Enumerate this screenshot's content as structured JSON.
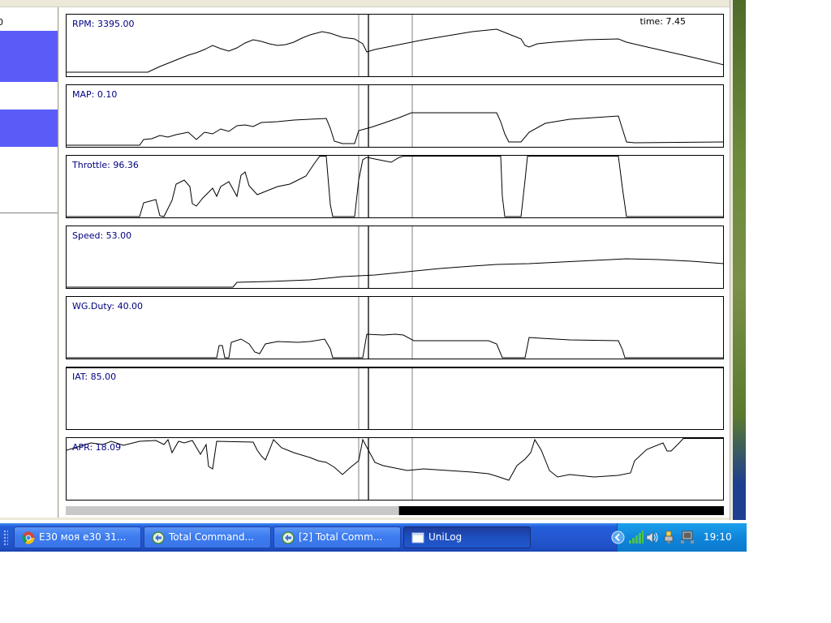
{
  "left_pane": {
    "partial_text": "0"
  },
  "time_readout": "time: 7.45",
  "panels": [
    {
      "key": "rpm",
      "label": "RPM: 3395.00",
      "points": [
        [
          0,
          71
        ],
        [
          100,
          71
        ],
        [
          115,
          64
        ],
        [
          130,
          58
        ],
        [
          150,
          50
        ],
        [
          160,
          47
        ],
        [
          170,
          43
        ],
        [
          180,
          38
        ],
        [
          190,
          42
        ],
        [
          200,
          45
        ],
        [
          210,
          41
        ],
        [
          220,
          35
        ],
        [
          230,
          31
        ],
        [
          240,
          33
        ],
        [
          250,
          36
        ],
        [
          260,
          38
        ],
        [
          270,
          37
        ],
        [
          280,
          34
        ],
        [
          290,
          29
        ],
        [
          300,
          25
        ],
        [
          315,
          21
        ],
        [
          325,
          23
        ],
        [
          340,
          28
        ],
        [
          355,
          30
        ],
        [
          365,
          36
        ],
        [
          370,
          46
        ],
        [
          380,
          43
        ],
        [
          400,
          39
        ],
        [
          420,
          35
        ],
        [
          440,
          31
        ],
        [
          470,
          26
        ],
        [
          500,
          21
        ],
        [
          530,
          18
        ],
        [
          545,
          24
        ],
        [
          560,
          30
        ],
        [
          565,
          38
        ],
        [
          570,
          40
        ],
        [
          580,
          36
        ],
        [
          600,
          34
        ],
        [
          640,
          31
        ],
        [
          680,
          30
        ],
        [
          690,
          34
        ],
        [
          720,
          41
        ],
        [
          760,
          50
        ],
        [
          790,
          57
        ],
        [
          810,
          62
        ]
      ]
    },
    {
      "key": "map",
      "label": "MAP: 0.10",
      "points": [
        [
          0,
          74
        ],
        [
          90,
          74
        ],
        [
          95,
          67
        ],
        [
          105,
          66
        ],
        [
          115,
          62
        ],
        [
          125,
          64
        ],
        [
          135,
          61
        ],
        [
          150,
          58
        ],
        [
          160,
          67
        ],
        [
          170,
          58
        ],
        [
          180,
          60
        ],
        [
          190,
          54
        ],
        [
          200,
          57
        ],
        [
          210,
          50
        ],
        [
          220,
          49
        ],
        [
          230,
          51
        ],
        [
          240,
          46
        ],
        [
          260,
          45
        ],
        [
          280,
          43
        ],
        [
          300,
          42
        ],
        [
          320,
          41
        ],
        [
          325,
          53
        ],
        [
          330,
          69
        ],
        [
          340,
          72
        ],
        [
          355,
          72
        ],
        [
          360,
          56
        ],
        [
          375,
          52
        ],
        [
          390,
          47
        ],
        [
          410,
          40
        ],
        [
          425,
          34
        ],
        [
          470,
          34
        ],
        [
          530,
          34
        ],
        [
          535,
          45
        ],
        [
          540,
          60
        ],
        [
          545,
          70
        ],
        [
          560,
          70
        ],
        [
          570,
          58
        ],
        [
          590,
          47
        ],
        [
          620,
          42
        ],
        [
          650,
          40
        ],
        [
          680,
          38
        ],
        [
          685,
          54
        ],
        [
          690,
          70
        ],
        [
          700,
          71
        ],
        [
          810,
          70
        ]
      ]
    },
    {
      "key": "throttle",
      "label": "Throttle: 96.36",
      "points": [
        [
          0,
          78
        ],
        [
          90,
          78
        ],
        [
          95,
          58
        ],
        [
          110,
          54
        ],
        [
          115,
          74
        ],
        [
          120,
          78
        ],
        [
          130,
          55
        ],
        [
          135,
          35
        ],
        [
          145,
          30
        ],
        [
          152,
          38
        ],
        [
          155,
          59
        ],
        [
          160,
          62
        ],
        [
          168,
          52
        ],
        [
          175,
          45
        ],
        [
          180,
          40
        ],
        [
          185,
          50
        ],
        [
          190,
          38
        ],
        [
          200,
          32
        ],
        [
          205,
          41
        ],
        [
          210,
          50
        ],
        [
          215,
          24
        ],
        [
          220,
          20
        ],
        [
          225,
          37
        ],
        [
          235,
          48
        ],
        [
          245,
          44
        ],
        [
          260,
          38
        ],
        [
          275,
          35
        ],
        [
          285,
          30
        ],
        [
          295,
          25
        ],
        [
          305,
          10
        ],
        [
          312,
          0
        ],
        [
          320,
          0
        ],
        [
          325,
          60
        ],
        [
          328,
          78
        ],
        [
          355,
          78
        ],
        [
          360,
          30
        ],
        [
          365,
          5
        ],
        [
          370,
          2
        ],
        [
          385,
          5
        ],
        [
          400,
          8
        ],
        [
          410,
          2
        ],
        [
          415,
          0
        ],
        [
          535,
          0
        ],
        [
          537,
          50
        ],
        [
          540,
          78
        ],
        [
          560,
          78
        ],
        [
          565,
          30
        ],
        [
          568,
          0
        ],
        [
          680,
          0
        ],
        [
          685,
          40
        ],
        [
          690,
          78
        ],
        [
          810,
          78
        ]
      ]
    },
    {
      "key": "speed",
      "label": "Speed: 53.00",
      "points": [
        [
          0,
          77
        ],
        [
          205,
          77
        ],
        [
          210,
          69
        ],
        [
          250,
          68
        ],
        [
          300,
          66
        ],
        [
          340,
          62
        ],
        [
          380,
          60
        ],
        [
          420,
          56
        ],
        [
          460,
          52
        ],
        [
          500,
          49
        ],
        [
          530,
          47
        ],
        [
          570,
          46
        ],
        [
          610,
          44
        ],
        [
          650,
          42
        ],
        [
          690,
          40
        ],
        [
          730,
          41
        ],
        [
          770,
          43
        ],
        [
          810,
          46
        ]
      ]
    },
    {
      "key": "wgduty",
      "label": "WG.Duty: 40.00",
      "points": [
        [
          0,
          78
        ],
        [
          185,
          78
        ],
        [
          188,
          60
        ],
        [
          192,
          60
        ],
        [
          195,
          78
        ],
        [
          200,
          78
        ],
        [
          203,
          56
        ],
        [
          215,
          52
        ],
        [
          225,
          58
        ],
        [
          232,
          68
        ],
        [
          238,
          70
        ],
        [
          245,
          58
        ],
        [
          260,
          55
        ],
        [
          285,
          56
        ],
        [
          300,
          55
        ],
        [
          318,
          52
        ],
        [
          325,
          64
        ],
        [
          328,
          78
        ],
        [
          365,
          78
        ],
        [
          370,
          46
        ],
        [
          390,
          47
        ],
        [
          405,
          46
        ],
        [
          415,
          47
        ],
        [
          428,
          54
        ],
        [
          470,
          54
        ],
        [
          520,
          54
        ],
        [
          530,
          58
        ],
        [
          537,
          75
        ],
        [
          540,
          78
        ],
        [
          565,
          78
        ],
        [
          570,
          50
        ],
        [
          585,
          51
        ],
        [
          620,
          53
        ],
        [
          680,
          54
        ],
        [
          685,
          65
        ],
        [
          688,
          78
        ],
        [
          810,
          78
        ]
      ]
    },
    {
      "key": "iat",
      "label": "IAT: 85.00",
      "points": [
        [
          0,
          0
        ],
        [
          810,
          0
        ]
      ]
    },
    {
      "key": "apr",
      "label": "APR: 18.09",
      "points": [
        [
          0,
          15
        ],
        [
          30,
          6
        ],
        [
          45,
          8
        ],
        [
          55,
          4
        ],
        [
          70,
          9
        ],
        [
          90,
          4
        ],
        [
          110,
          3
        ],
        [
          120,
          8
        ],
        [
          125,
          2
        ],
        [
          130,
          18
        ],
        [
          138,
          4
        ],
        [
          145,
          6
        ],
        [
          155,
          3
        ],
        [
          165,
          20
        ],
        [
          172,
          8
        ],
        [
          175,
          35
        ],
        [
          180,
          38
        ],
        [
          185,
          4
        ],
        [
          230,
          5
        ],
        [
          235,
          15
        ],
        [
          240,
          22
        ],
        [
          245,
          27
        ],
        [
          250,
          15
        ],
        [
          255,
          2
        ],
        [
          265,
          12
        ],
        [
          280,
          18
        ],
        [
          300,
          24
        ],
        [
          310,
          28
        ],
        [
          320,
          30
        ],
        [
          330,
          36
        ],
        [
          340,
          45
        ],
        [
          350,
          36
        ],
        [
          360,
          28
        ],
        [
          365,
          2
        ],
        [
          372,
          15
        ],
        [
          380,
          30
        ],
        [
          390,
          34
        ],
        [
          410,
          38
        ],
        [
          420,
          40
        ],
        [
          440,
          38
        ],
        [
          470,
          40
        ],
        [
          500,
          42
        ],
        [
          520,
          44
        ],
        [
          530,
          47
        ],
        [
          545,
          52
        ],
        [
          555,
          34
        ],
        [
          565,
          26
        ],
        [
          572,
          18
        ],
        [
          577,
          2
        ],
        [
          585,
          15
        ],
        [
          595,
          40
        ],
        [
          605,
          48
        ],
        [
          620,
          45
        ],
        [
          650,
          48
        ],
        [
          680,
          46
        ],
        [
          695,
          43
        ],
        [
          700,
          28
        ],
        [
          715,
          14
        ],
        [
          735,
          6
        ],
        [
          740,
          16
        ],
        [
          745,
          16
        ],
        [
          755,
          6
        ],
        [
          760,
          0
        ],
        [
          810,
          0
        ]
      ]
    }
  ],
  "cursor_lines": [
    360,
    372,
    426
  ],
  "scrollbar": {
    "position_fraction": 0.505
  },
  "taskbar": {
    "buttons": [
      {
        "label": "E30 моя e30 31...",
        "icon": "chrome-icon",
        "active": false
      },
      {
        "label": "Total Command...",
        "icon": "total-commander-icon",
        "active": false
      },
      {
        "label": "[2] Total Comm...",
        "icon": "total-commander-icon",
        "active": false
      },
      {
        "label": "UniLog",
        "icon": "window-icon",
        "active": true
      }
    ],
    "clock": "19:10"
  },
  "colors": {
    "selection": "#5a5cf8",
    "taskbar": "#2457d0",
    "tray": "#0f86dc"
  }
}
